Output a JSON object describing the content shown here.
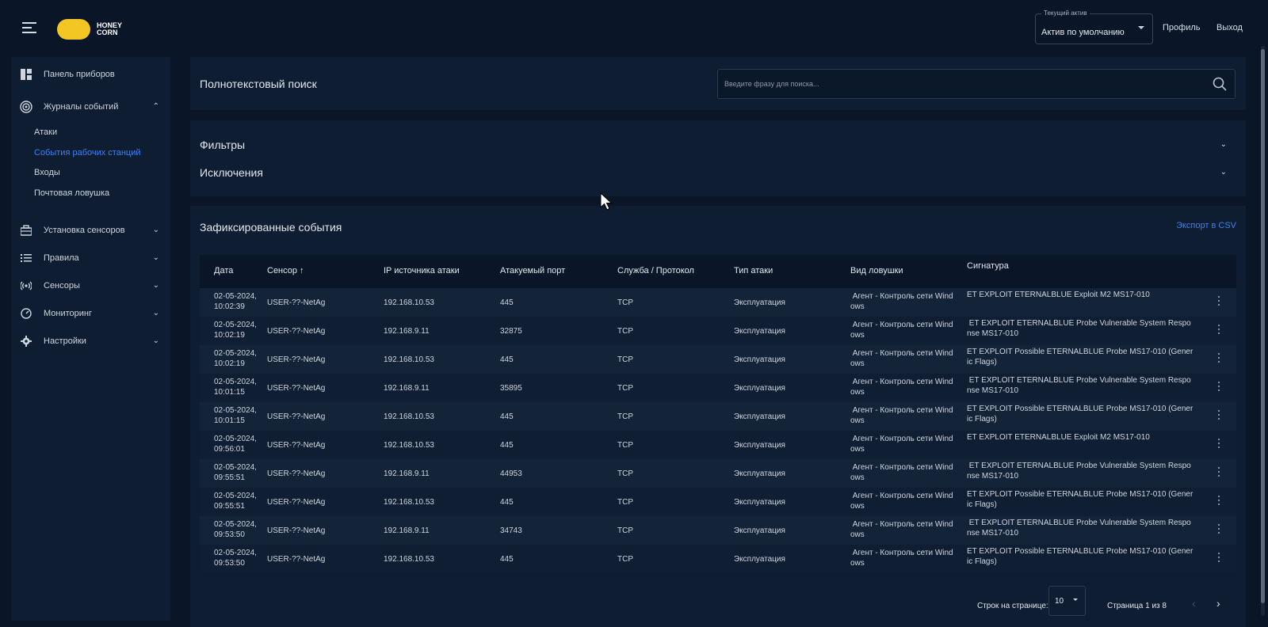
{
  "header": {
    "logo_text": "HONEY CORN",
    "asset_select": {
      "label": "Текущий актив",
      "value": "Актив по умолчанию"
    },
    "profile_label": "Профиль",
    "logout_label": "Выход"
  },
  "sidebar": {
    "items": [
      {
        "label": "Панель приборов",
        "icon": "dashboard-icon"
      },
      {
        "label": "Журналы событий",
        "icon": "target-icon"
      },
      {
        "label": "Установка сенсоров",
        "icon": "briefcase-icon"
      },
      {
        "label": "Правила",
        "icon": "list-icon"
      },
      {
        "label": "Сенсоры",
        "icon": "radio-icon"
      },
      {
        "label": "Мониторинг",
        "icon": "gauge-icon"
      },
      {
        "label": "Настройки",
        "icon": "gear-icon"
      }
    ],
    "subitems": [
      {
        "label": "Атаки",
        "active": false
      },
      {
        "label": "События рабочих станций",
        "active": true
      },
      {
        "label": "Входы",
        "active": false
      },
      {
        "label": "Почтовая ловушка",
        "active": false
      }
    ]
  },
  "search": {
    "title": "Полнотекстовый поиск",
    "placeholder": "Введите фразу для поиска..."
  },
  "filters": {
    "filters_label": "Фильтры",
    "exclusions_label": "Исключения"
  },
  "events": {
    "title": "Зафиксированные события",
    "export_label": "Экспорт в CSV",
    "columns": [
      "Дата",
      "Сенсор ↑",
      "IP источника атаки",
      "Атакуемый порт",
      "Служба / Протокол",
      "Тип атаки",
      "Вид ловушки",
      "Сигнатура"
    ],
    "rows": [
      {
        "date": "02-05-2024,",
        "time": "10:02:39",
        "sensor": "USER-??-NetAg",
        "ip": "192.168.10.53",
        "port": "445",
        "proto": "TCP",
        "type": "Эксплуатация",
        "trap1": " Агент - Контроль сети Wind",
        "trap2": "ows",
        "sig1": "ET EXPLOIT ETERNALBLUE Exploit M2 MS17-010",
        "sig2": ""
      },
      {
        "date": "02-05-2024,",
        "time": "10:02:19",
        "sensor": "USER-??-NetAg",
        "ip": "192.168.9.11",
        "port": "32875",
        "proto": "TCP",
        "type": "Эксплуатация",
        "trap1": " Агент - Контроль сети Wind",
        "trap2": "ows",
        "sig1": " ET EXPLOIT ETERNALBLUE Probe Vulnerable System Respo",
        "sig2": "nse MS17-010"
      },
      {
        "date": "02-05-2024,",
        "time": "10:02:19",
        "sensor": "USER-??-NetAg",
        "ip": "192.168.10.53",
        "port": "445",
        "proto": "TCP",
        "type": "Эксплуатация",
        "trap1": " Агент - Контроль сети Wind",
        "trap2": "ows",
        "sig1": "ET EXPLOIT Possible ETERNALBLUE Probe MS17-010 (Gener",
        "sig2": "ic Flags)"
      },
      {
        "date": "02-05-2024,",
        "time": "10:01:15",
        "sensor": "USER-??-NetAg",
        "ip": "192.168.9.11",
        "port": "35895",
        "proto": "TCP",
        "type": "Эксплуатация",
        "trap1": " Агент - Контроль сети Wind",
        "trap2": "ows",
        "sig1": " ET EXPLOIT ETERNALBLUE Probe Vulnerable System Respo",
        "sig2": "nse MS17-010"
      },
      {
        "date": "02-05-2024,",
        "time": "10:01:15",
        "sensor": "USER-??-NetAg",
        "ip": "192.168.10.53",
        "port": "445",
        "proto": "TCP",
        "type": "Эксплуатация",
        "trap1": " Агент - Контроль сети Wind",
        "trap2": "ows",
        "sig1": "ET EXPLOIT Possible ETERNALBLUE Probe MS17-010 (Gener",
        "sig2": "ic Flags)"
      },
      {
        "date": "02-05-2024,",
        "time": "09:56:01",
        "sensor": "USER-??-NetAg",
        "ip": "192.168.10.53",
        "port": "445",
        "proto": "TCP",
        "type": "Эксплуатация",
        "trap1": " Агент - Контроль сети Wind",
        "trap2": "ows",
        "sig1": "ET EXPLOIT ETERNALBLUE Exploit M2 MS17-010",
        "sig2": ""
      },
      {
        "date": "02-05-2024,",
        "time": "09:55:51",
        "sensor": "USER-??-NetAg",
        "ip": "192.168.9.11",
        "port": "44953",
        "proto": "TCP",
        "type": "Эксплуатация",
        "trap1": " Агент - Контроль сети Wind",
        "trap2": "ows",
        "sig1": " ET EXPLOIT ETERNALBLUE Probe Vulnerable System Respo",
        "sig2": "nse MS17-010"
      },
      {
        "date": "02-05-2024,",
        "time": "09:55:51",
        "sensor": "USER-??-NetAg",
        "ip": "192.168.10.53",
        "port": "445",
        "proto": "TCP",
        "type": "Эксплуатация",
        "trap1": " Агент - Контроль сети Wind",
        "trap2": "ows",
        "sig1": "ET EXPLOIT Possible ETERNALBLUE Probe MS17-010 (Gener",
        "sig2": "ic Flags)"
      },
      {
        "date": "02-05-2024,",
        "time": "09:53:50",
        "sensor": "USER-??-NetAg",
        "ip": "192.168.9.11",
        "port": "34743",
        "proto": "TCP",
        "type": "Эксплуатация",
        "trap1": " Агент - Контроль сети Wind",
        "trap2": "ows",
        "sig1": " ET EXPLOIT ETERNALBLUE Probe Vulnerable System Respo",
        "sig2": "nse MS17-010"
      },
      {
        "date": "02-05-2024,",
        "time": "09:53:50",
        "sensor": "USER-??-NetAg",
        "ip": "192.168.10.53",
        "port": "445",
        "proto": "TCP",
        "type": "Эксплуатация",
        "trap1": " Агент - Контроль сети Wind",
        "trap2": "ows",
        "sig1": "ET EXPLOIT Possible ETERNALBLUE Probe MS17-010 (Gener",
        "sig2": "ic Flags)"
      }
    ]
  },
  "pagination": {
    "rows_label": "Строк на странице:",
    "rows_value": "10",
    "page_info": "Страница 1 из 8"
  },
  "colors": {
    "background": "#0a1628",
    "card": "#0e1d31",
    "accent": "#3b82f6",
    "logo": "#f3c623"
  }
}
